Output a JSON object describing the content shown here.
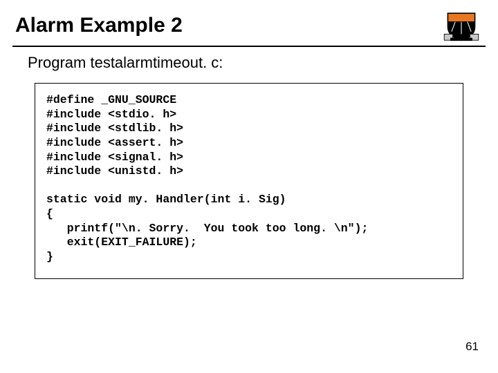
{
  "title": "Alarm Example 2",
  "subtitle": "Program testalarmtimeout. c:",
  "code": {
    "l1": "#define _GNU_SOURCE",
    "l2": "#include <stdio. h>",
    "l3": "#include <stdlib. h>",
    "l4": "#include <assert. h>",
    "l5": "#include <signal. h>",
    "l6": "#include <unistd. h>",
    "l7": "",
    "l8": "static void my. Handler(int i. Sig)",
    "l9": "{",
    "l10": "   printf(\"\\n. Sorry.  You took too long. \\n\");",
    "l11": "   exit(EXIT_FAILURE);",
    "l12": "}"
  },
  "page_number": "61",
  "logo_alt": "Princeton shield logo"
}
